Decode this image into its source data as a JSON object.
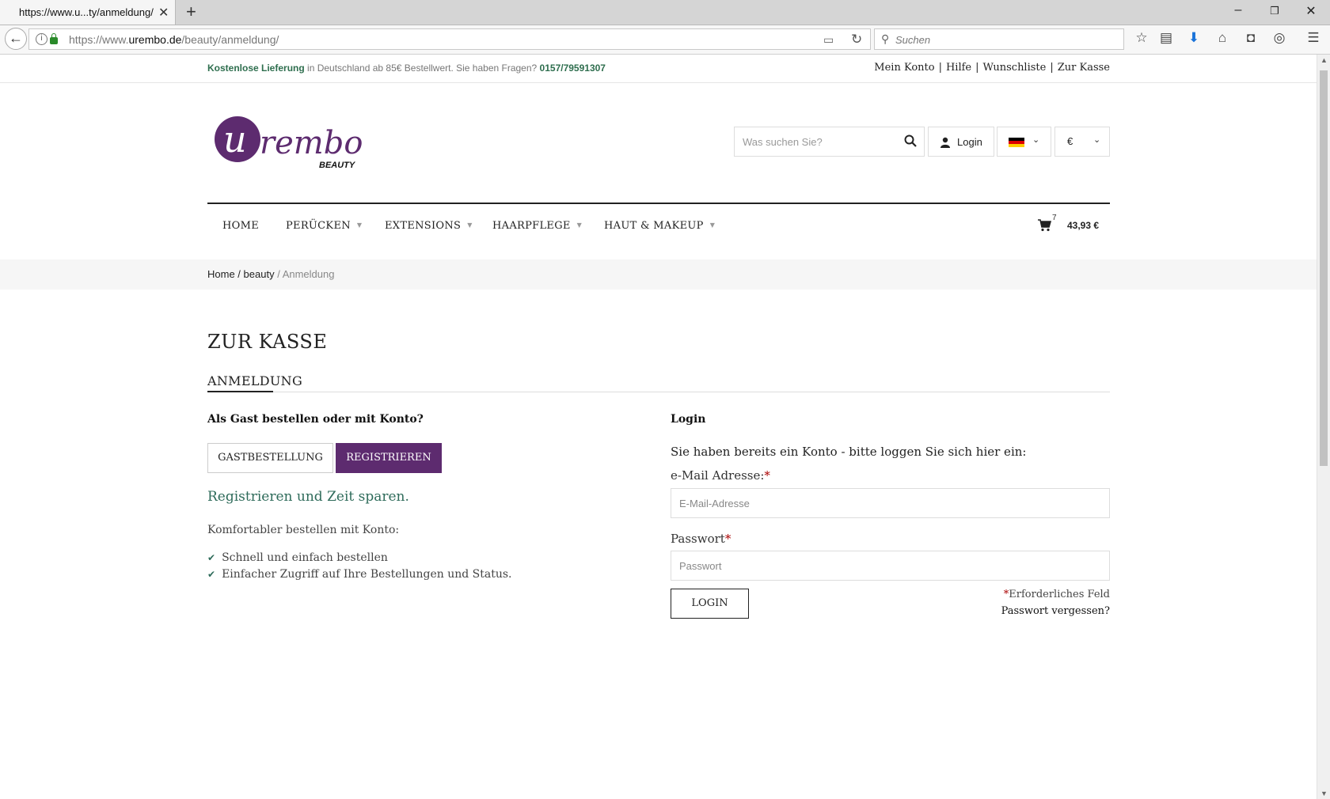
{
  "browser": {
    "tab_title": "https://www.u...ty/anmeldung/",
    "url_host_prefix": "https://www.",
    "url_host": "urembo.de",
    "url_path": "/beauty/anmeldung/",
    "search_placeholder": "Suchen"
  },
  "topinfo": {
    "free_delivery": "Kostenlose Lieferung",
    "delivery_text": " in Deutschland ab 85€ Bestellwert. Sie haben Fragen? ",
    "phone": "0157/79591307",
    "links": [
      "Mein Konto",
      "Hilfe",
      "Wunschliste",
      "Zur Kasse"
    ]
  },
  "header": {
    "logo_text": "urembo",
    "logo_sub": "BEAUTY",
    "search_placeholder": "Was suchen Sie?",
    "login_label": "Login",
    "currency": "€"
  },
  "nav": {
    "items": [
      "HOME",
      "PERÜCKEN",
      "EXTENSIONS",
      "HAARPFLEGE",
      "HAUT & MAKEUP"
    ],
    "cart_count": "7",
    "cart_total": "43,93 €"
  },
  "breadcrumb": {
    "home": "Home",
    "sep": " / ",
    "beauty": "beauty",
    "current": "Anmeldung"
  },
  "main": {
    "title": "ZUR KASSE",
    "section_tab": "ANMELDUNG",
    "guest_heading": "Als Gast bestellen oder mit Konto?",
    "guest_button": "GASTBESTELLUNG",
    "register_button": "REGISTRIEREN",
    "register_headline": "Registrieren und Zeit sparen.",
    "comfort_text": "Komfortabler bestellen mit Konto:",
    "benefits": [
      "Schnell und einfach bestellen",
      "Einfacher Zugriff auf Ihre Bestellungen und Status."
    ],
    "login_heading": "Login",
    "login_intro": "Sie haben bereits ein Konto - bitte loggen Sie sich hier ein:",
    "email_label": "e-Mail Adresse:",
    "email_placeholder": "E-Mail-Adresse",
    "password_label": "Passwort",
    "password_placeholder": "Passwort",
    "login_button": "LOGIN",
    "required_note": "Erforderliches Feld",
    "forgot_password": "Passwort vergessen?",
    "required_mark": "*"
  },
  "colors": {
    "brand_purple": "#5d2b6f",
    "accent_green": "#2e6b5a"
  }
}
